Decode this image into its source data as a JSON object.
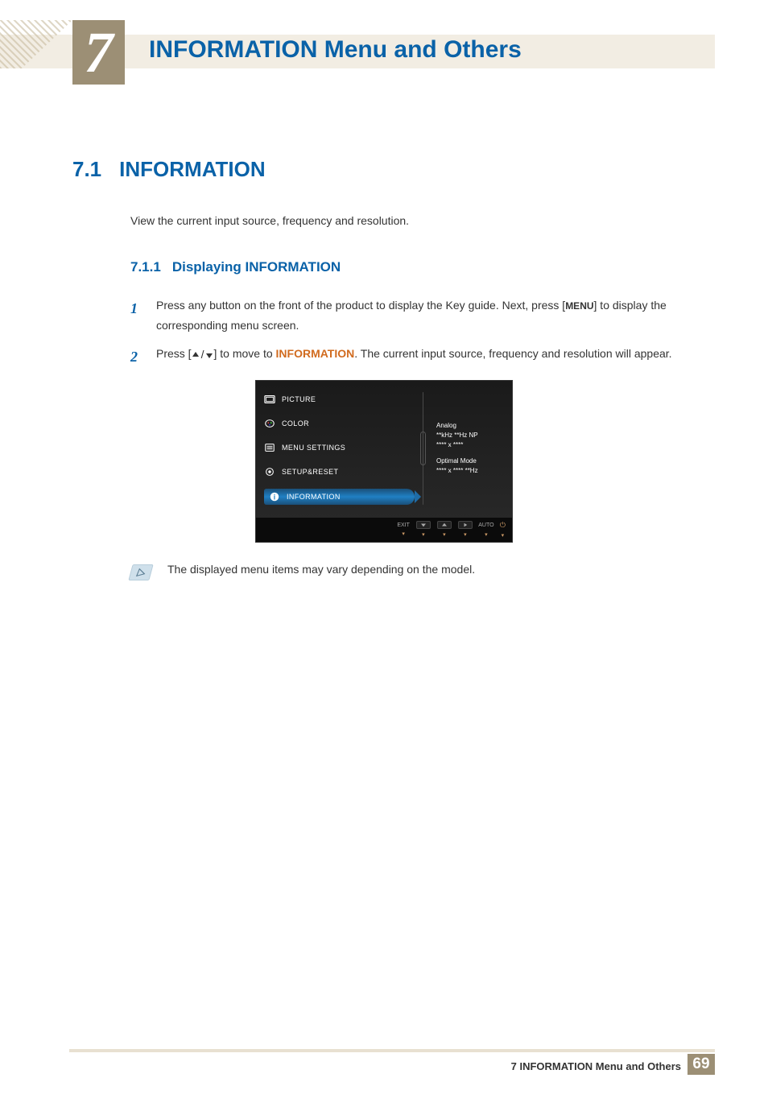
{
  "chapter": {
    "num": "7",
    "title": "INFORMATION Menu and Others"
  },
  "section": {
    "num": "7.1",
    "title": "INFORMATION"
  },
  "intro": "View the current input source, frequency and resolution.",
  "subsection": {
    "num": "7.1.1",
    "title": "Displaying INFORMATION"
  },
  "steps": {
    "s1_num": "1",
    "s1_a": "Press any button on the front of the product to display the Key guide. Next, press [",
    "s1_menu": "MENU",
    "s1_b": "] to display the corresponding menu screen.",
    "s2_num": "2",
    "s2_a": "Press [",
    "s2_b": "] to move to ",
    "s2_info": "INFORMATION",
    "s2_c": ". The current input source, frequency and resolution will appear."
  },
  "osd": {
    "menu": {
      "picture": "PICTURE",
      "color": "COLOR",
      "menu_settings": "MENU SETTINGS",
      "setup_reset": "SETUP&RESET",
      "information": "INFORMATION"
    },
    "right": {
      "l1": "Analog",
      "l2": "**kHz **Hz NP",
      "l3": "**** x ****",
      "l4": "Optimal Mode",
      "l5": "**** x **** **Hz"
    },
    "footer": {
      "exit": "EXIT",
      "auto": "AUTO"
    }
  },
  "note": "The displayed menu items may vary depending on the model.",
  "footer": {
    "text": "7 INFORMATION Menu and Others",
    "page": "69"
  }
}
